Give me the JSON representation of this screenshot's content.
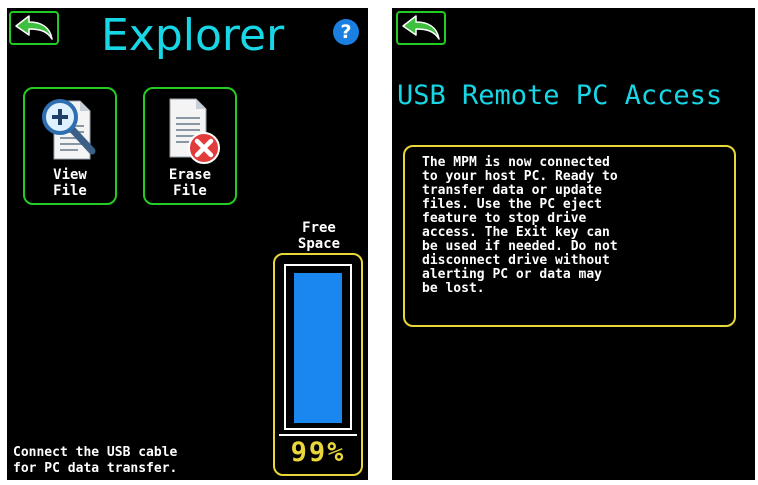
{
  "left_screen": {
    "title": "Explorer",
    "help_glyph": "?",
    "back_icon": "back-arrow-icon",
    "buttons": [
      {
        "label": "View\nFile",
        "icon": "magnify-document-icon"
      },
      {
        "label": "Erase\nFile",
        "icon": "erase-document-icon"
      }
    ],
    "free_space": {
      "label": "Free\nSpace",
      "value_text": "99%",
      "fraction": 0.99
    },
    "status_text": "Connect the USB cable\nfor PC data transfer."
  },
  "right_screen": {
    "back_icon": "back-arrow-icon",
    "title": "USB Remote PC Access",
    "message": "The MPM is now connected\nto your host PC. Ready to\ntransfer data or update\nfiles. Use the PC eject\nfeature to stop drive\naccess. The Exit key can\nbe used if needed. Do not\ndisconnect drive without\nalerting PC or data may\nbe lost."
  },
  "colors": {
    "screen_bg": "#000000",
    "title_cyan": "#17d7e6",
    "button_border_green": "#22cc22",
    "gauge_yellow": "#e8d63b",
    "gauge_fill_blue": "#1a86f0",
    "help_blue": "#1a7fe0"
  }
}
